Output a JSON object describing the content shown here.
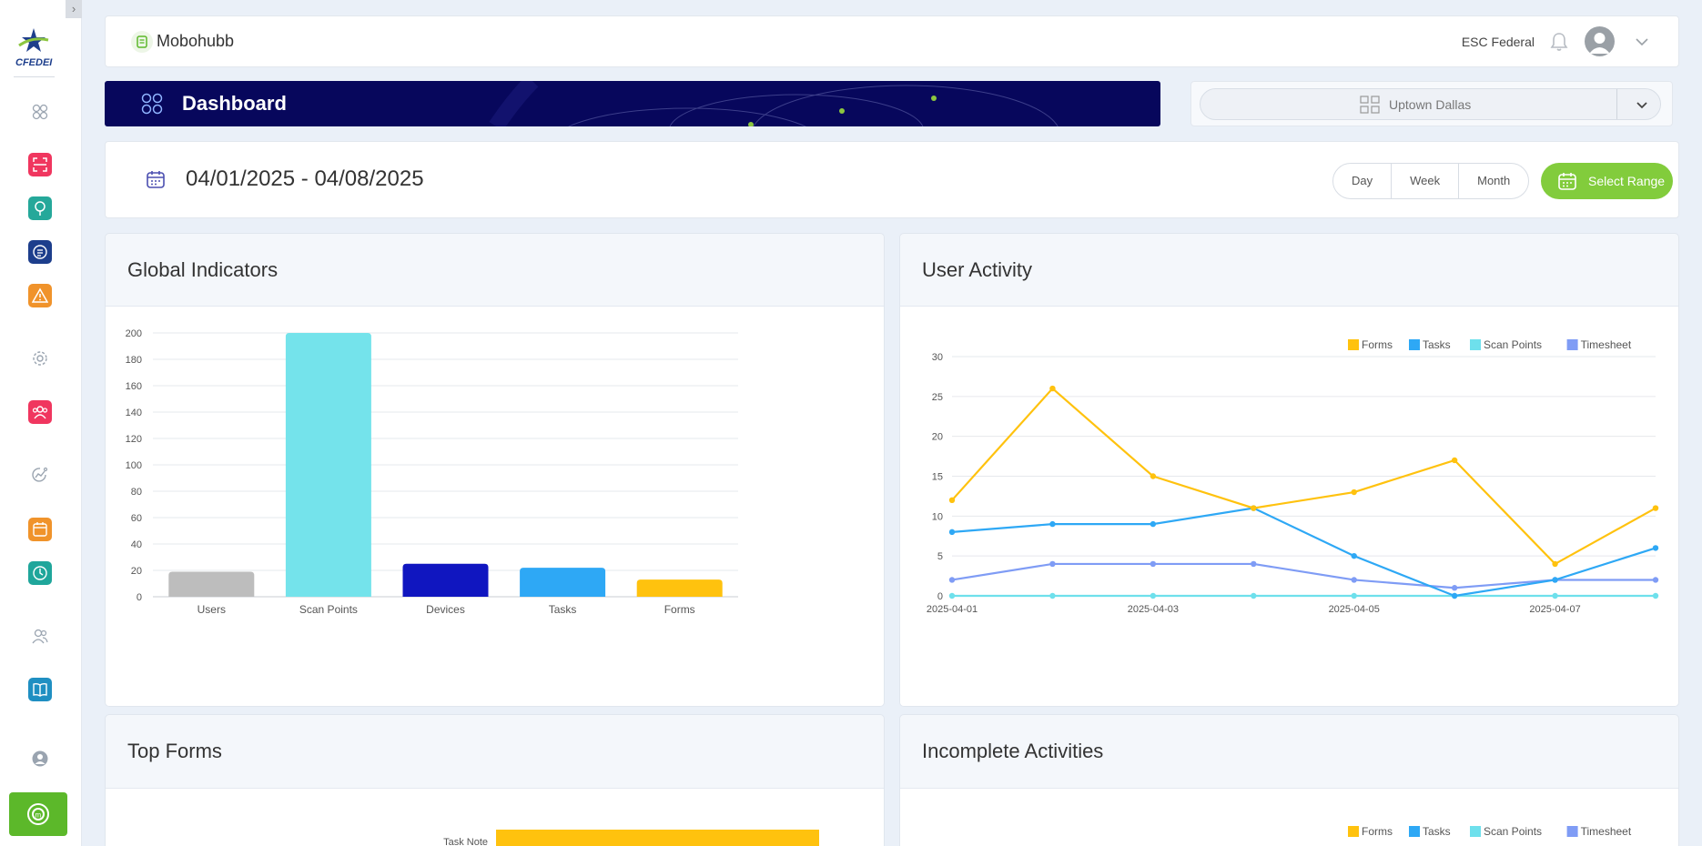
{
  "sidebar": {
    "collapse_glyph": "›",
    "logo_text": "CFEDEI",
    "icons": [
      {
        "name": "dashboard-grid-icon",
        "bg": "#ffffff",
        "fg": "#9aa4b0"
      },
      {
        "name": "scan-icon",
        "bg": "#f0365f",
        "fg": "#ffffff"
      },
      {
        "name": "location-pin-icon",
        "bg": "#25a89a",
        "fg": "#ffffff"
      },
      {
        "name": "forms-icon",
        "bg": "#1d3e8c",
        "fg": "#ffffff"
      },
      {
        "name": "alert-icon",
        "bg": "#f0932b",
        "fg": "#ffffff"
      },
      {
        "name": "gear-icon",
        "bg": "#ffffff",
        "fg": "#9aa4b0"
      },
      {
        "name": "team-icon",
        "bg": "#f0365f",
        "fg": "#ffffff"
      },
      {
        "name": "analytics-icon",
        "bg": "#ffffff",
        "fg": "#9aa4b0"
      },
      {
        "name": "calendar-icon",
        "bg": "#f0932b",
        "fg": "#ffffff"
      },
      {
        "name": "clock-icon",
        "bg": "#1fa69b",
        "fg": "#ffffff"
      },
      {
        "name": "users-icon",
        "bg": "#ffffff",
        "fg": "#9aa4b0"
      },
      {
        "name": "book-icon",
        "bg": "#1f8fc2",
        "fg": "#ffffff"
      },
      {
        "name": "profile-icon",
        "bg": "#ffffff",
        "fg": "#9aa4b0"
      }
    ]
  },
  "header": {
    "app_name": "Mobohubb",
    "org_name": "ESC Federal"
  },
  "banner": {
    "title": "Dashboard"
  },
  "location": {
    "selected": "Uptown Dallas"
  },
  "date_bar": {
    "range": "04/01/2025 - 04/08/2025",
    "periods": [
      "Day",
      "Week",
      "Month"
    ],
    "select_range_label": "Select Range"
  },
  "cards": {
    "global_indicators": "Global Indicators",
    "user_activity": "User Activity",
    "top_forms": "Top Forms",
    "incomplete_activities": "Incomplete Activities"
  },
  "colors": {
    "brand_green": "#82cc3c",
    "banner_navy": "#07075c",
    "forms": "#ffc20e",
    "tasks": "#2ea8f5",
    "scan_points": "#6ee0ec",
    "timesheet": "#7f9cf5"
  },
  "chart_data": [
    {
      "type": "bar",
      "title": "",
      "categories": [
        "Users",
        "Scan Points",
        "Devices",
        "Tasks",
        "Forms"
      ],
      "values": [
        19,
        200,
        25,
        22,
        13
      ],
      "colors": [
        "#bdbdbd",
        "#74e3eb",
        "#1016c0",
        "#2ea8f5",
        "#ffc20e"
      ],
      "yticks": [
        0,
        20,
        40,
        60,
        80,
        100,
        120,
        140,
        160,
        180,
        200
      ],
      "ylim": [
        0,
        200
      ],
      "grid": true,
      "legend": "none"
    },
    {
      "type": "line",
      "title": "",
      "x": [
        "2025-04-01",
        "2025-04-02",
        "2025-04-03",
        "2025-04-04",
        "2025-04-05",
        "2025-04-06",
        "2025-04-07",
        "2025-04-08"
      ],
      "xtick_labels": [
        "2025-04-01",
        "",
        "2025-04-03",
        "",
        "2025-04-05",
        "",
        "2025-04-07",
        ""
      ],
      "series": [
        {
          "name": "Forms",
          "color": "#ffc20e",
          "values": [
            12,
            26,
            15,
            11,
            13,
            17,
            4,
            11
          ]
        },
        {
          "name": "Tasks",
          "color": "#2ea8f5",
          "values": [
            8,
            9,
            9,
            11,
            5,
            0,
            2,
            6
          ]
        },
        {
          "name": "Scan Points",
          "color": "#6ee0ec",
          "values": [
            0,
            0,
            0,
            0,
            0,
            0,
            0,
            0
          ]
        },
        {
          "name": "Timesheet",
          "color": "#7f9cf5",
          "values": [
            2,
            4,
            4,
            4,
            2,
            1,
            2,
            2
          ]
        }
      ],
      "yticks": [
        0,
        5,
        10,
        15,
        20,
        25,
        30
      ],
      "ylim": [
        0,
        30
      ],
      "grid": true,
      "legend": "top-right"
    },
    {
      "type": "bar",
      "title": "",
      "orientation": "horizontal",
      "categories": [
        "Task Note"
      ],
      "colors": [
        "#ffc20e"
      ],
      "legend": "none"
    },
    {
      "type": "line",
      "title": "",
      "series": [
        {
          "name": "Forms",
          "color": "#ffc20e"
        },
        {
          "name": "Tasks",
          "color": "#2ea8f5"
        },
        {
          "name": "Scan Points",
          "color": "#6ee0ec"
        },
        {
          "name": "Timesheet",
          "color": "#7f9cf5"
        }
      ],
      "legend": "top-right"
    }
  ]
}
